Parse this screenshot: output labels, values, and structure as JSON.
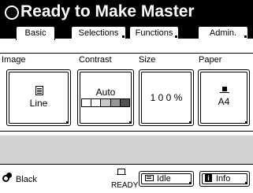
{
  "header": {
    "status_title": "Ready to Make Master"
  },
  "tabs": [
    {
      "label": "Basic",
      "active": true
    },
    {
      "label": "Selections",
      "active": false
    },
    {
      "label": "Functions",
      "active": false
    },
    {
      "label": "Admin.",
      "active": false
    }
  ],
  "settings": {
    "image": {
      "label": "Image",
      "value": "Line",
      "icon": "document-icon"
    },
    "contrast": {
      "label": "Contrast",
      "value": "Auto",
      "scale_colors": [
        "#ffffff",
        "#ffffff",
        "#c8c8c8",
        "#969696",
        "#505050"
      ]
    },
    "size": {
      "label": "Size",
      "value": "1 0 0 %"
    },
    "paper": {
      "label": "Paper",
      "value": "A4",
      "icon": "paper-icon"
    }
  },
  "footer": {
    "ink_color": "Black",
    "status": "READY",
    "idle_button": "Idle",
    "info_button": "Info"
  },
  "colors": {
    "header_bg": "#000000",
    "strip_bg": "#d3d3d3"
  }
}
